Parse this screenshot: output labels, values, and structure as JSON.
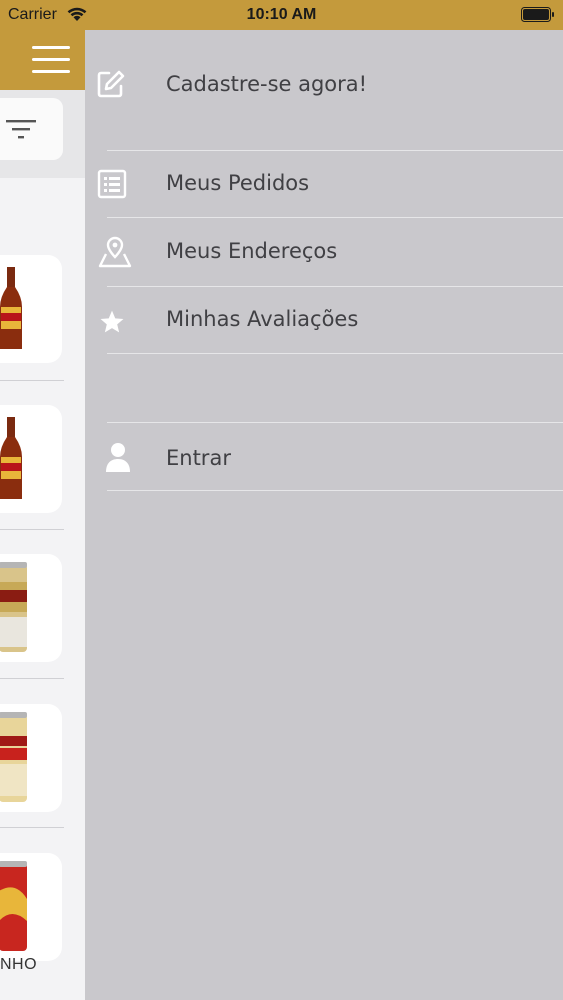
{
  "status_bar": {
    "carrier": "Carrier",
    "time": "10:10 AM"
  },
  "theme": {
    "accent": "#c49a3c",
    "drawer_bg": "#c9c8cc",
    "menu_text": "#404044"
  },
  "background_app": {
    "partial_text": "NHO"
  },
  "drawer": {
    "register": {
      "label": "Cadastre-se agora!",
      "icon": "edit-icon"
    },
    "orders": {
      "label": "Meus Pedidos",
      "icon": "list-icon"
    },
    "addresses": {
      "label": "Meus Endereços",
      "icon": "map-pin-icon"
    },
    "reviews": {
      "label": "Minhas Avaliações",
      "icon": "star-icon"
    },
    "login": {
      "label": "Entrar",
      "icon": "user-icon"
    }
  }
}
